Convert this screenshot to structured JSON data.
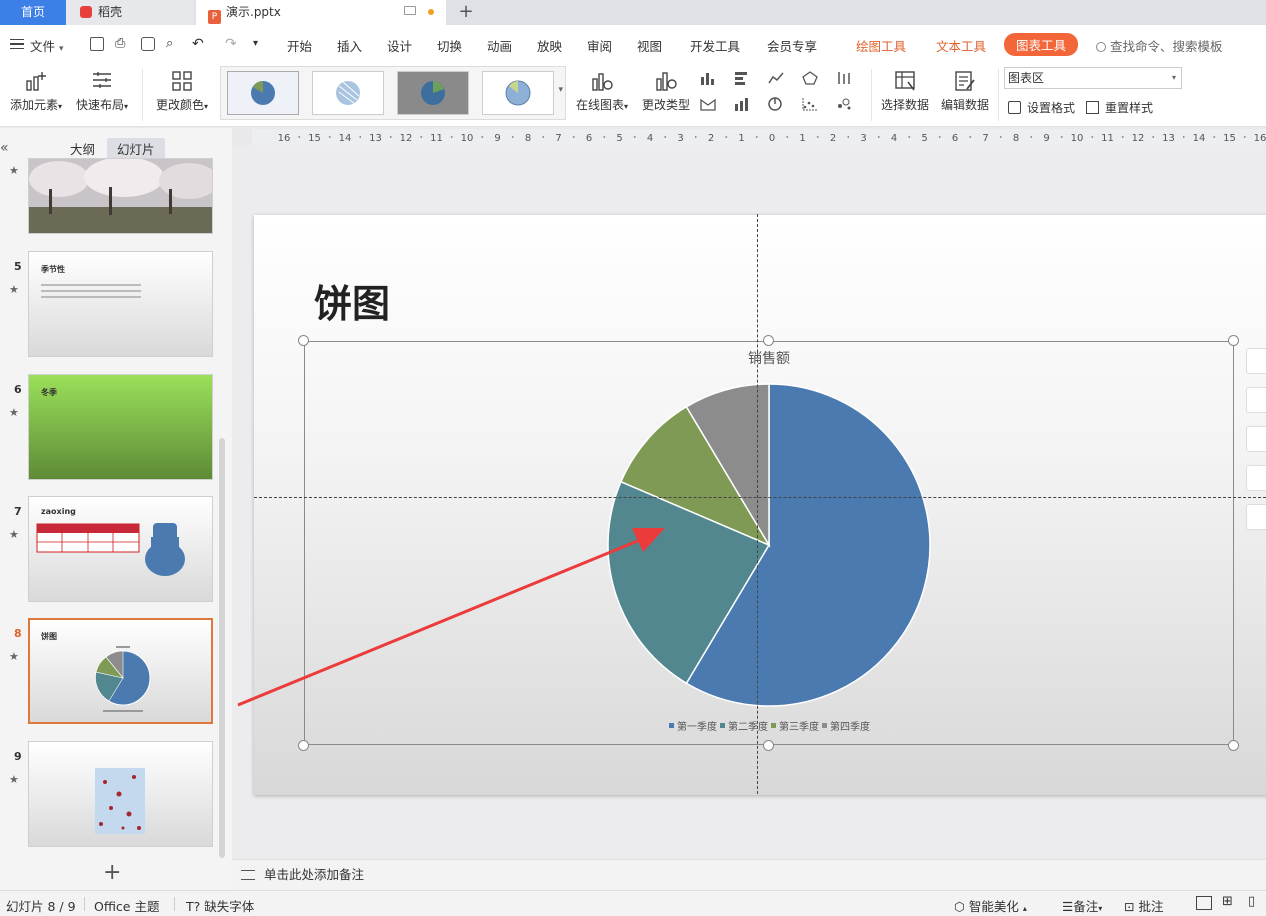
{
  "tabs": {
    "home": "首页",
    "daoke": "稻壳",
    "file": "演示.pptx",
    "file_icon": "P"
  },
  "menu": {
    "file": "文件",
    "items": [
      "开始",
      "插入",
      "设计",
      "切换",
      "动画",
      "放映",
      "审阅",
      "视图",
      "开发工具",
      "会员专享"
    ],
    "draw_tools": "绘图工具",
    "text_tools": "文本工具",
    "chart_tools": "图表工具",
    "search": "查找命令、搜索模板",
    "accent_color": "#f3663a"
  },
  "ribbon": {
    "add_element": "添加元素",
    "quick_layout": "快速布局",
    "change_color": "更改颜色",
    "online_chart": "在线图表",
    "change_type": "更改类型",
    "select_data": "选择数据",
    "edit_data": "编辑数据",
    "chart_area": "图表区",
    "set_format": "设置格式",
    "reset_style": "重置样式"
  },
  "left_panel": {
    "outline_tab": "大纲",
    "slides_tab": "幻灯片",
    "slides": [
      {
        "num": "",
        "title": ""
      },
      {
        "num": "5",
        "title": "季节性"
      },
      {
        "num": "6",
        "title": "冬季"
      },
      {
        "num": "7",
        "title": "zaoxing"
      },
      {
        "num": "8",
        "title": "饼图"
      },
      {
        "num": "9",
        "title": ""
      }
    ]
  },
  "ruler_labels": [
    "16",
    "15",
    "14",
    "13",
    "12",
    "11",
    "10",
    "9",
    "8",
    "7",
    "6",
    "5",
    "4",
    "3",
    "2",
    "1",
    "0",
    "1",
    "2",
    "3",
    "4",
    "5",
    "6",
    "7",
    "8",
    "9",
    "10",
    "11",
    "12",
    "13",
    "14",
    "15",
    "16"
  ],
  "slide": {
    "title": "饼图"
  },
  "chart_data": {
    "type": "pie",
    "title": "销售额",
    "categories": [
      "第一季度",
      "第二季度",
      "第三季度",
      "第四季度"
    ],
    "values": [
      8.2,
      3.2,
      1.4,
      1.2
    ],
    "colors": [
      "#4a7ab0",
      "#52878f",
      "#7f9a55",
      "#8c8c8c"
    ],
    "legend": "bottom"
  },
  "notes": {
    "placeholder": "单击此处添加备注"
  },
  "status": {
    "slide_counter": "幻灯片 8 / 9",
    "theme": "Office 主题",
    "missing_fonts": "缺失字体",
    "smart_beautify": "智能美化",
    "notes": "备注",
    "comments": "批注"
  }
}
